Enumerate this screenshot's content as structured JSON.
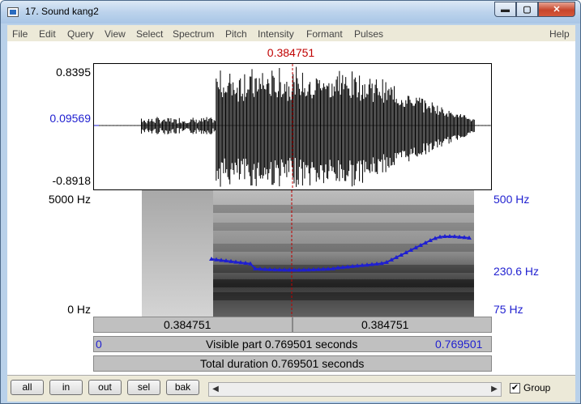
{
  "window": {
    "title": "17. Sound kang2",
    "min_glyph": "▬",
    "max_glyph": "▢",
    "close_glyph": "✕"
  },
  "menu": [
    "File",
    "Edit",
    "Query",
    "View",
    "Select",
    "Spectrum",
    "Pitch",
    "Intensity",
    "Formant",
    "Pulses",
    "Help"
  ],
  "cursor_time": "0.384751",
  "waveform": {
    "max_label": "0.8395",
    "cursor_value_label": "0.09569",
    "min_label": "-0.8918"
  },
  "spectrogram": {
    "top_freq_label": "5000 Hz",
    "bottom_freq_label": "0 Hz",
    "pitch_top_label": "500 Hz",
    "pitch_cursor_label": "230.6 Hz",
    "pitch_bottom_label": "75 Hz"
  },
  "selection_row": {
    "left_time": "0.384751",
    "right_time": "0.384751"
  },
  "visible_row": {
    "start": "0",
    "text": "Visible part 0.769501 seconds",
    "end": "0.769501"
  },
  "total_row": {
    "text": "Total duration 0.769501 seconds"
  },
  "buttons": {
    "all": "all",
    "in": "in",
    "out": "out",
    "sel": "sel",
    "bak": "bak"
  },
  "group": {
    "label": "Group",
    "checked": true
  },
  "colors": {
    "cursor": "#c00000",
    "pitch": "#1f1fd0"
  }
}
